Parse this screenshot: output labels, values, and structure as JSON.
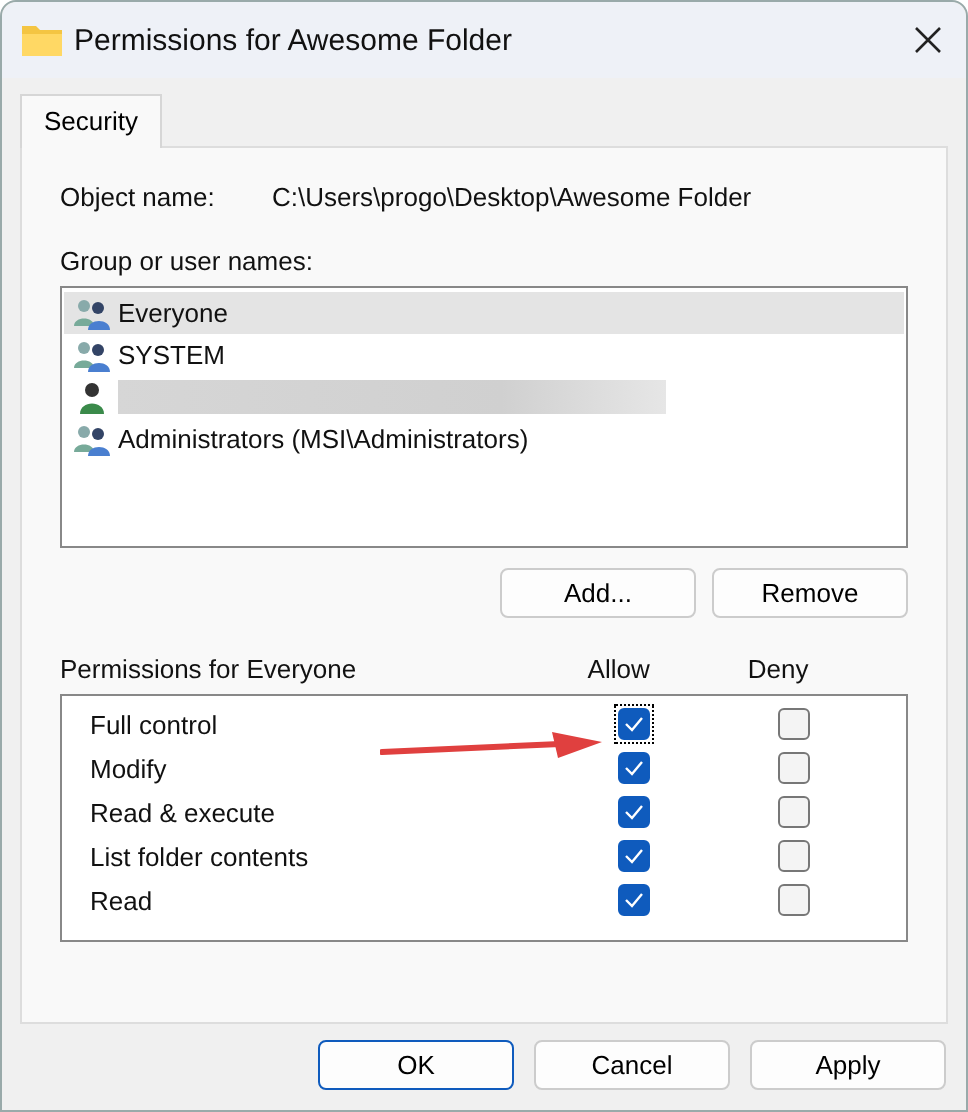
{
  "window": {
    "title": "Permissions for Awesome Folder"
  },
  "tabs": [
    {
      "label": "Security",
      "selected": true
    }
  ],
  "object_name": {
    "label": "Object name:",
    "value": "C:\\Users\\progo\\Desktop\\Awesome Folder"
  },
  "groups": {
    "label": "Group or user names:",
    "items": [
      {
        "kind": "group",
        "name": "Everyone",
        "selected": true
      },
      {
        "kind": "group",
        "name": "SYSTEM",
        "selected": false
      },
      {
        "kind": "redacted",
        "selected": false
      },
      {
        "kind": "group",
        "name": "Administrators (MSI\\Administrators)",
        "selected": false
      }
    ]
  },
  "group_buttons": [
    "Add...",
    "Remove"
  ],
  "permissions": {
    "label": "Permissions for Everyone",
    "allow_header": "Allow",
    "deny_header": "Deny",
    "rows": [
      {
        "name": "Full control",
        "allow": true,
        "deny": false,
        "focused": true
      },
      {
        "name": "Modify",
        "allow": true,
        "deny": false,
        "focused": false
      },
      {
        "name": "Read & execute",
        "allow": true,
        "deny": false,
        "focused": false
      },
      {
        "name": "List folder contents",
        "allow": true,
        "deny": false,
        "focused": false
      },
      {
        "name": "Read",
        "allow": true,
        "deny": false,
        "focused": false
      }
    ]
  },
  "annotation": {
    "kind": "arrow",
    "color": "#e0403f"
  },
  "buttons": [
    {
      "label": "OK",
      "default": true
    },
    {
      "label": "Cancel",
      "default": false
    },
    {
      "label": "Apply",
      "default": false
    }
  ]
}
